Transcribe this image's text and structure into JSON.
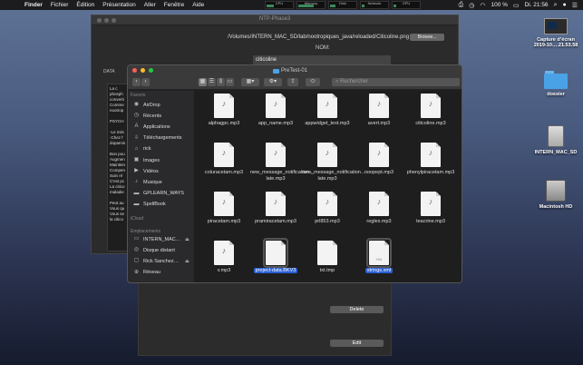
{
  "menubar": {
    "apple_icon": "apple-icon",
    "items": [
      "Finder",
      "Fichier",
      "Édition",
      "Présentation",
      "Aller",
      "Fenêtre",
      "Aide"
    ],
    "meters": [
      {
        "label": "CPU",
        "level": 0.3
      },
      {
        "label": "Memory",
        "level": 0.6
      },
      {
        "label": "Disk",
        "level": 0.2
      },
      {
        "label": "Network",
        "level": 0.1
      },
      {
        "label": "GPU",
        "level": 0.1
      }
    ],
    "battery": "100 %",
    "clock": "Di. 21:56"
  },
  "desktop": {
    "screenshot_label": "Capture d’écran 2019-10….21.53.58",
    "folder_label": "dossier",
    "usb_label": "INTERN_MAC_SD",
    "hd_label": "Macintosh HD"
  },
  "ntp_window": {
    "title": "NTP-Phase3",
    "path": "/Volumes/INTERN_MAC_SD/lab/nootropiques_java/reloaded/Citicoline.png",
    "browse_label": "Browse...",
    "nom_label": "NOM:",
    "nom_value": "citicoline",
    "data_label": "DATA",
    "text_lines": [
      "La c",
      "phosph",
      "converti",
      "Comme",
      "nootrop",
      "",
      "PSYCH",
      "",
      "-Le méc",
      "-Chez l'",
      "dopamin",
      "",
      "Bon pou",
      "Augmen",
      "Maintien",
      "Compen",
      "Soin ré",
      "C'est pc",
      "La citico",
      "maladie",
      "",
      "Peut au",
      "Vous qu",
      "Vous se",
      "la citico"
    ],
    "delete_label": "Delete",
    "edit_label": "Edit"
  },
  "finder": {
    "title": "PreTest-01",
    "search_placeholder": "Rechercher",
    "favorites_header": "Favoris",
    "favorites": [
      {
        "label": "AirDrop",
        "icon": "airdrop-icon"
      },
      {
        "label": "Récents",
        "icon": "clock-icon"
      },
      {
        "label": "Applications",
        "icon": "applications-icon"
      },
      {
        "label": "Téléchargements",
        "icon": "download-icon"
      },
      {
        "label": "rick",
        "icon": "home-icon"
      },
      {
        "label": "Images",
        "icon": "images-icon"
      },
      {
        "label": "Vidéos",
        "icon": "video-icon"
      },
      {
        "label": "Musique",
        "icon": "music-icon"
      },
      {
        "label": "GPLEARN_WAYS",
        "icon": "folder-icon"
      },
      {
        "label": "SpellBook",
        "icon": "folder-icon"
      }
    ],
    "icloud_header": "iCloud",
    "locations_header": "Emplacements",
    "locations": [
      {
        "label": "INTERN_MAC…",
        "icon": "drive-icon"
      },
      {
        "label": "Disque distant",
        "icon": "disc-icon"
      },
      {
        "label": "Rick Sanchez…",
        "icon": "computer-icon"
      },
      {
        "label": "Réseau",
        "icon": "network-icon"
      }
    ],
    "files": [
      {
        "name": "alphagpc.mp3",
        "kind": "audio"
      },
      {
        "name": "app_name.mp3",
        "kind": "audio"
      },
      {
        "name": "appwidget_text.mp3",
        "kind": "audio"
      },
      {
        "name": "avert.mp3",
        "kind": "audio"
      },
      {
        "name": "citicoline.mp3",
        "kind": "audio"
      },
      {
        "name": "coluracetam.mp3",
        "kind": "audio"
      },
      {
        "name": "new_message_notification…late.mp3",
        "kind": "audio"
      },
      {
        "name": "new_message_notification…late.mp3",
        "kind": "audio"
      },
      {
        "name": "noopept.mp3",
        "kind": "audio"
      },
      {
        "name": "phenylpiracetam.mp3",
        "kind": "audio"
      },
      {
        "name": "piracetam.mp3",
        "kind": "audio"
      },
      {
        "name": "pramiracetam.mp3",
        "kind": "audio"
      },
      {
        "name": "prl853.mp3",
        "kind": "audio"
      },
      {
        "name": "regles.mp3",
        "kind": "audio"
      },
      {
        "name": "teacrine.mp3",
        "kind": "audio"
      },
      {
        "name": "v.mp3",
        "kind": "audio"
      },
      {
        "name": "project-data.BKV3",
        "kind": "doc",
        "selected": true
      },
      {
        "name": "txt.tmp",
        "kind": "doc"
      },
      {
        "name": "strings.xml",
        "kind": "xml",
        "tag": "XML",
        "selected": true
      }
    ]
  }
}
